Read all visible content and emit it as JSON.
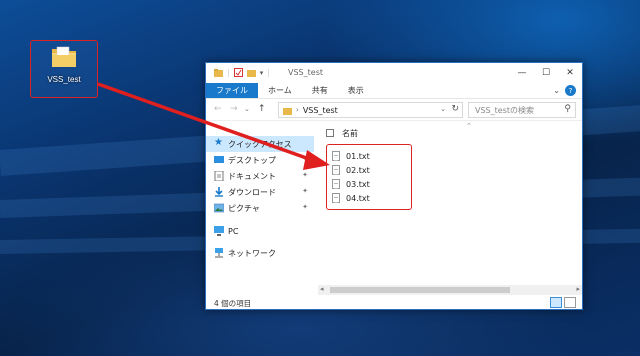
{
  "desktop": {
    "icon_label": "VSS_test"
  },
  "window": {
    "title": "VSS_test",
    "controls": {
      "minimize": "—",
      "maximize": "☐",
      "close": "✕"
    }
  },
  "ribbon": {
    "tabs": [
      "ファイル",
      "ホーム",
      "共有",
      "表示"
    ],
    "expand": "⌄",
    "help": "?"
  },
  "navbar": {
    "back": "←",
    "forward": "→",
    "recent": "⌄",
    "up": "↑",
    "address": "VSS_test",
    "search_placeholder": "VSS_testの検索"
  },
  "nav_pane": {
    "items": [
      {
        "label": "クイックアクセス",
        "icon": "star-icon"
      },
      {
        "label": "デスクトップ",
        "icon": "desktop-icon"
      },
      {
        "label": "ドキュメント",
        "icon": "document-icon"
      },
      {
        "label": "ダウンロード",
        "icon": "download-icon"
      },
      {
        "label": "ピクチャ",
        "icon": "picture-icon"
      },
      {
        "label": "PC",
        "icon": "pc-icon"
      },
      {
        "label": "ネットワーク",
        "icon": "network-icon"
      }
    ]
  },
  "content": {
    "column_header": "名前",
    "files": [
      "01.txt",
      "02.txt",
      "03.txt",
      "04.txt"
    ]
  },
  "status": {
    "text": "4 個の項目"
  },
  "colors": {
    "accent": "#1979ca",
    "highlight": "#cce8ff",
    "annotation_red": "#dd2222"
  }
}
